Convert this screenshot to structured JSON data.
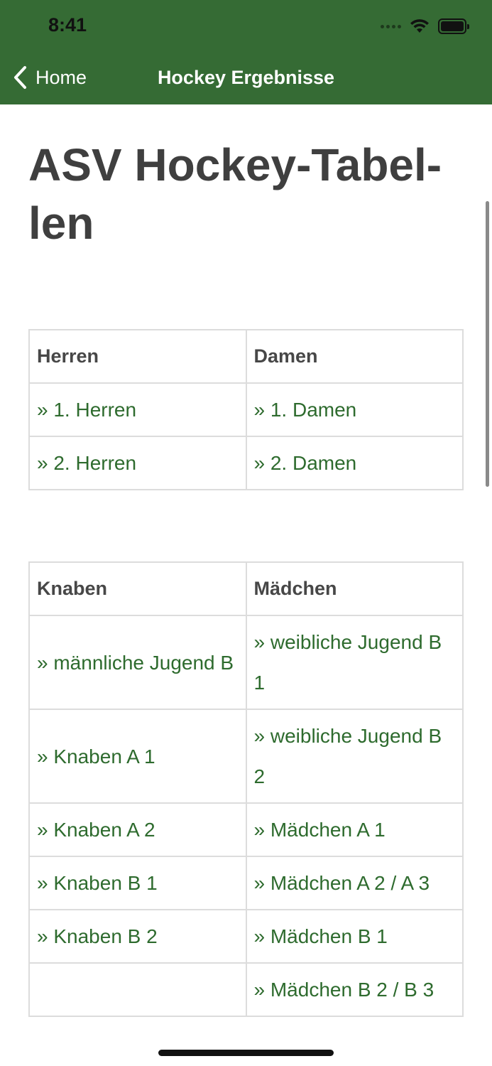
{
  "status_bar": {
    "time": "8:41"
  },
  "nav": {
    "back_label": "Home",
    "title": "Hockey Ergebnisse"
  },
  "page": {
    "title": "ASV Hockey-Tabel-len"
  },
  "table1": {
    "headers": [
      "Herren",
      "Damen"
    ],
    "rows": [
      [
        "» 1. Herren",
        "» 1. Damen"
      ],
      [
        "» 2. Herren",
        "» 2. Damen"
      ]
    ]
  },
  "table2": {
    "headers": [
      "Knaben",
      "Mädchen"
    ],
    "rows": [
      [
        "» männliche Jugend B",
        "» weibliche Jugend B 1"
      ],
      [
        "» Knaben A 1",
        "» weibliche Jugend B 2"
      ],
      [
        "» Knaben A 2",
        "» Mädchen A 1"
      ],
      [
        "» Knaben B 1",
        "» Mädchen A 2 / A 3"
      ],
      [
        "» Knaben B 2",
        "» Mädchen B 1"
      ],
      [
        "",
        "» Mädchen B 2 / B 3"
      ]
    ]
  },
  "colors": {
    "header_bg": "#356b34",
    "link": "#2e6b2e",
    "title": "#3f3f3f"
  }
}
